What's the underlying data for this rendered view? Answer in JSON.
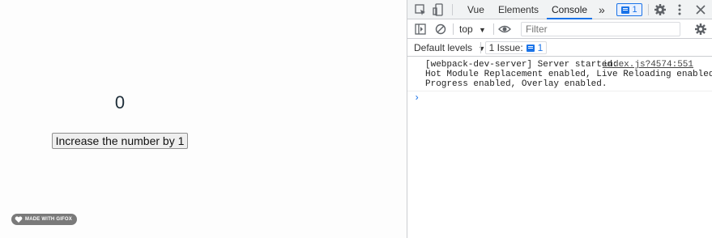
{
  "app": {
    "counter": "0",
    "increase_button": "Increase the number by 1",
    "badge": "MADE WITH GIFOX"
  },
  "devtools": {
    "tabs": [
      "Vue",
      "Elements",
      "Console"
    ],
    "active_tab": "Console",
    "overflow": "»",
    "issues_count": "1",
    "context": "top",
    "filter_placeholder": "Filter",
    "levels": "Default levels",
    "issue_label": "1 Issue:",
    "issue_count": "1",
    "log": {
      "lines": [
        "[webpack-dev-server] Server started:",
        "Hot Module Replacement enabled, Live Reloading enabled,",
        "Progress enabled, Overlay enabled."
      ],
      "source": "index.js?4574:551"
    },
    "prompt": "›"
  },
  "colors": {
    "accent": "#1a73e8",
    "tabbar_bg": "#f1f3f4",
    "border": "#cbcdd1"
  }
}
